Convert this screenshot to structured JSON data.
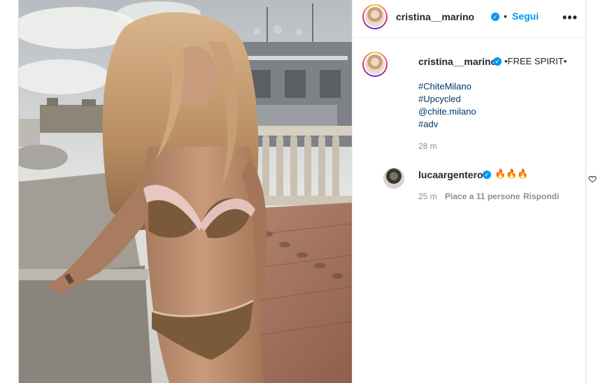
{
  "post": {
    "author": "cristina__marino",
    "follow_label": "Segui",
    "separator": "•",
    "more_label": "•••",
    "caption": "•FREE SPIRIT•",
    "hashtags": [
      "#ChiteMilano",
      "#Upcycled",
      "@chite.milano",
      "#adv"
    ],
    "caption_time": "28 m"
  },
  "comment": {
    "author": "lucaargentero",
    "text": "🔥🔥🔥",
    "time": "25 m",
    "likes": "Piace a 11 persone",
    "reply_label": "Rispondi"
  },
  "icons": {
    "verified": "verified-badge-icon",
    "like": "heart-outline-icon",
    "more": "more-options-icon"
  },
  "colors": {
    "link_blue": "#0095f6",
    "hashtag": "#00376b",
    "muted": "#8e8e8e",
    "text": "#262626"
  }
}
